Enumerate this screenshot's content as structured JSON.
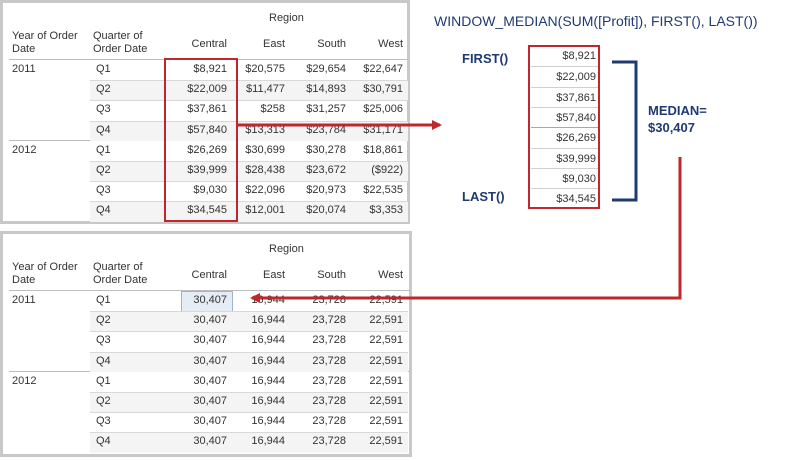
{
  "formula": "WINDOW_MEDIAN(SUM([Profit]), FIRST(), LAST())",
  "first_label": "FIRST()",
  "last_label": "LAST()",
  "median_label": "MEDIAN=",
  "median_value": "$30,407",
  "median_list": [
    "$8,921",
    "$22,009",
    "$37,861",
    "$57,840",
    "$26,269",
    "$39,999",
    "$9,030",
    "$34,545"
  ],
  "colors": {
    "accent_red": "#c0272d",
    "dark_blue": "#1f3a73",
    "highlight": "#e4ecf5"
  },
  "table1": {
    "region_label": "Region",
    "row_header_1": "Year of Order Date",
    "row_header_2": "Quarter of Order Date",
    "columns": [
      "Central",
      "East",
      "South",
      "West"
    ],
    "years": [
      "2011",
      "2012"
    ],
    "quarters": [
      "Q1",
      "Q2",
      "Q3",
      "Q4",
      "Q1",
      "Q2",
      "Q3",
      "Q4"
    ],
    "rows": [
      [
        "$8,921",
        "$20,575",
        "$29,654",
        "$22,647"
      ],
      [
        "$22,009",
        "$11,477",
        "$14,893",
        "$30,791"
      ],
      [
        "$37,861",
        "$258",
        "$31,257",
        "$25,006"
      ],
      [
        "$57,840",
        "$13,313",
        "$23,784",
        "$31,171"
      ],
      [
        "$26,269",
        "$30,699",
        "$30,278",
        "$18,861"
      ],
      [
        "$39,999",
        "$28,438",
        "$23,672",
        "($922)"
      ],
      [
        "$9,030",
        "$22,096",
        "$20,973",
        "$22,535"
      ],
      [
        "$34,545",
        "$12,001",
        "$20,074",
        "$3,353"
      ]
    ]
  },
  "table2": {
    "region_label": "Region",
    "row_header_1": "Year of Order Date",
    "row_header_2": "Quarter of Order Date",
    "columns": [
      "Central",
      "East",
      "South",
      "West"
    ],
    "years": [
      "2011",
      "2012"
    ],
    "quarters": [
      "Q1",
      "Q2",
      "Q3",
      "Q4",
      "Q1",
      "Q2",
      "Q3",
      "Q4"
    ],
    "rows": [
      [
        "30,407",
        "16,944",
        "23,728",
        "22,591"
      ],
      [
        "30,407",
        "16,944",
        "23,728",
        "22,591"
      ],
      [
        "30,407",
        "16,944",
        "23,728",
        "22,591"
      ],
      [
        "30,407",
        "16,944",
        "23,728",
        "22,591"
      ],
      [
        "30,407",
        "16,944",
        "23,728",
        "22,591"
      ],
      [
        "30,407",
        "16,944",
        "23,728",
        "22,591"
      ],
      [
        "30,407",
        "16,944",
        "23,728",
        "22,591"
      ],
      [
        "30,407",
        "16,944",
        "23,728",
        "22,591"
      ]
    ]
  }
}
